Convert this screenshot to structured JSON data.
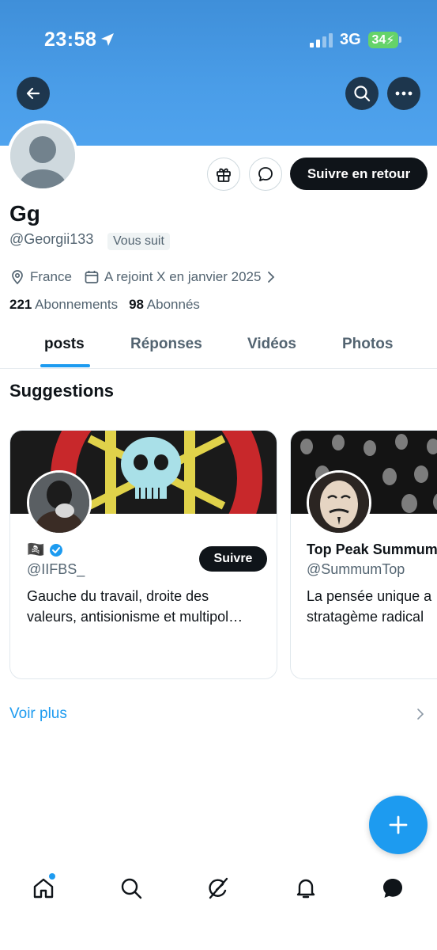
{
  "status_bar": {
    "time": "23:58",
    "network": "3G",
    "battery": "34"
  },
  "profile": {
    "name": "Gg",
    "handle": "@Georgii133",
    "follows_you": "Vous suit",
    "location": "France",
    "joined": "A rejoint X en janvier 2025",
    "following_count": "221",
    "following_label": "Abonnements",
    "followers_count": "98",
    "followers_label": "Abonnés"
  },
  "actions": {
    "follow_back_label": "Suivre en retour"
  },
  "tabs": [
    {
      "label": "posts",
      "active": true
    },
    {
      "label": "Réponses",
      "active": false
    },
    {
      "label": "Vidéos",
      "active": false
    },
    {
      "label": "Photos",
      "active": false
    }
  ],
  "suggestions": {
    "title": "Suggestions",
    "cards": [
      {
        "name": "🏴‍☠️",
        "verified": true,
        "handle": "@IIFBS_",
        "bio_line1": "Gauche du travail, droite des",
        "bio_line2": "valeurs, antisionisme et multipol…",
        "follow_label": "Suivre"
      },
      {
        "name": "Top Peak Summum",
        "verified": false,
        "handle": "@SummumTop",
        "bio_line1": "La pensée unique a",
        "bio_line2": "stratagème radical"
      }
    ],
    "see_more": "Voir plus"
  },
  "colors": {
    "accent": "#1d9bf0",
    "banner": "#4a9de8",
    "dark": "#0f1419",
    "muted": "#536471"
  },
  "icons": [
    "back-arrow-icon",
    "search-icon",
    "more-icon",
    "gift-icon",
    "message-icon",
    "location-icon",
    "calendar-icon",
    "chevron-right-icon",
    "verified-icon",
    "compose-icon",
    "home-icon",
    "grok-icon",
    "bell-icon",
    "chat-icon"
  ]
}
